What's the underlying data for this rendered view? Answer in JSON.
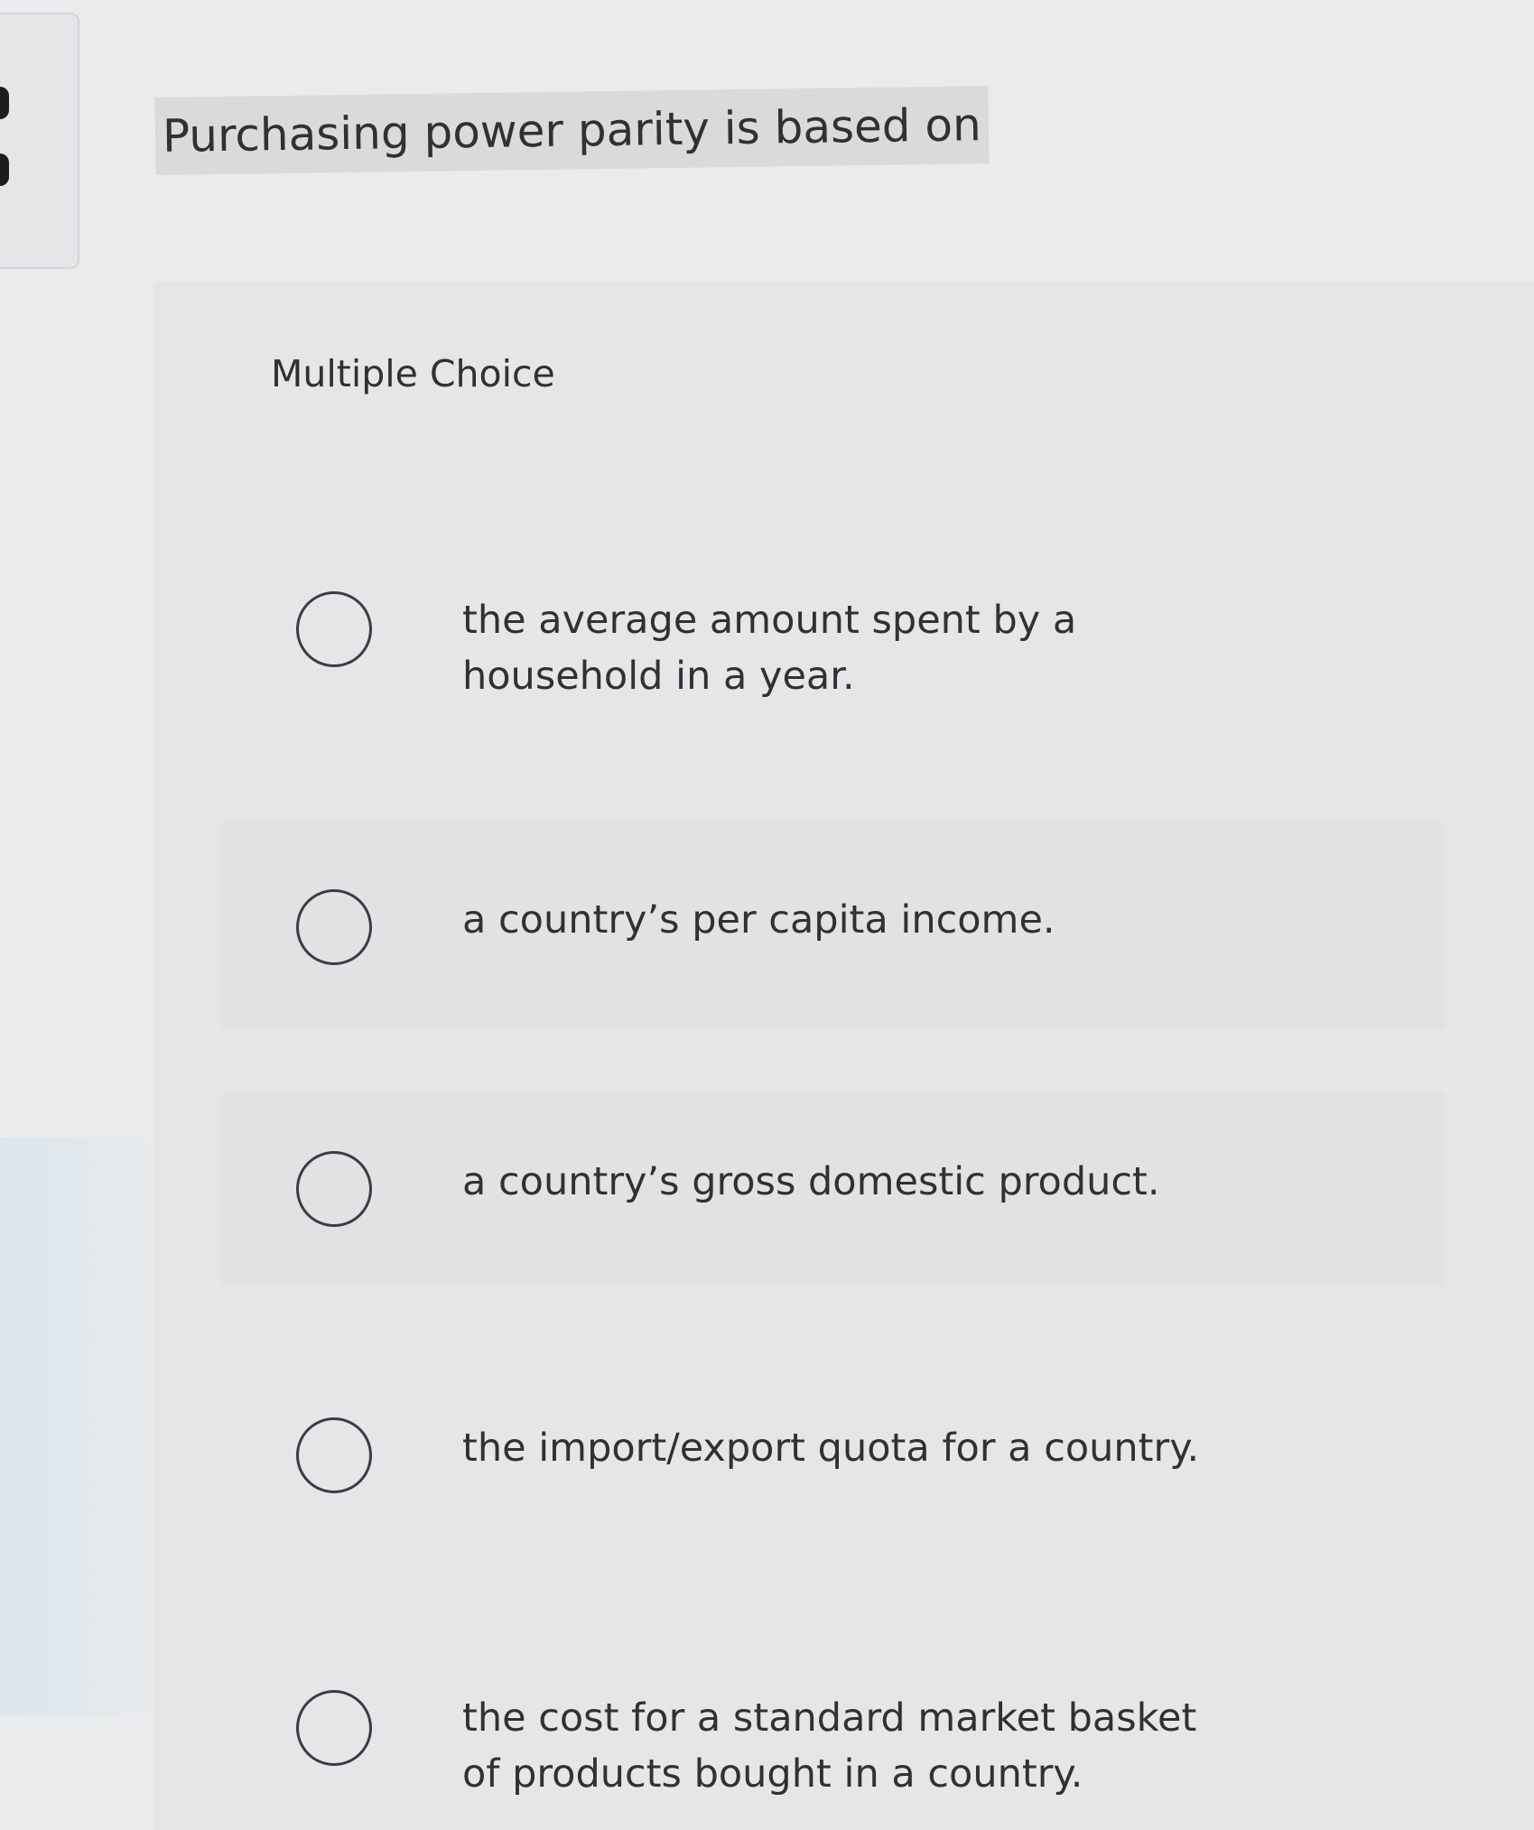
{
  "question": {
    "text": "Purchasing power parity is based on"
  },
  "answer_section": {
    "label": "Multiple Choice",
    "options": [
      {
        "text": "the average amount spent by a household in a year.",
        "selected": false
      },
      {
        "text": "a country’s per capita income.",
        "selected": false
      },
      {
        "text": "a country’s gross domestic product.",
        "selected": false
      },
      {
        "text": "the import/export quota for a country.",
        "selected": false
      },
      {
        "text": "the cost for a standard market basket of products bought in a country.",
        "selected": false
      }
    ]
  }
}
